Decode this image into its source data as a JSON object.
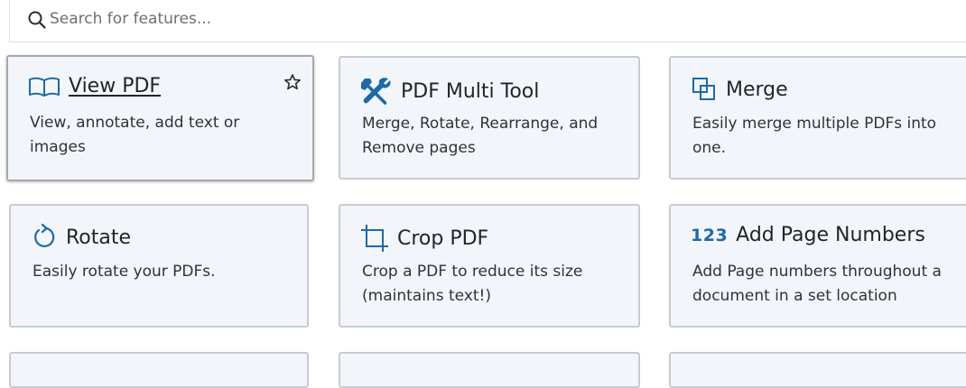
{
  "search": {
    "placeholder": "Search for features..."
  },
  "colors": {
    "accent": "#1c6aa8",
    "card_bg": "#f2f5fa",
    "card_border": "#c8ccd2"
  },
  "cards": [
    {
      "title": "View PDF",
      "description": "View, annotate, add text or images",
      "icon": "book-open-icon",
      "favorite_icon": "star-icon",
      "selected": true
    },
    {
      "title": "PDF Multi Tool",
      "description": "Merge, Rotate, Rearrange, and Remove pages",
      "icon": "tools-icon"
    },
    {
      "title": "Merge",
      "description": "Easily merge multiple PDFs into one.",
      "icon": "merge-icon"
    },
    {
      "title": "Rotate",
      "description": "Easily rotate your PDFs.",
      "icon": "rotate-icon"
    },
    {
      "title": "Crop PDF",
      "description": "Crop a PDF to reduce its size (maintains text!)",
      "icon": "crop-icon"
    },
    {
      "title": "Add Page Numbers",
      "description": "Add Page numbers throughout a document in a set location",
      "icon": "page-numbers-icon",
      "icon_text": "123"
    }
  ]
}
